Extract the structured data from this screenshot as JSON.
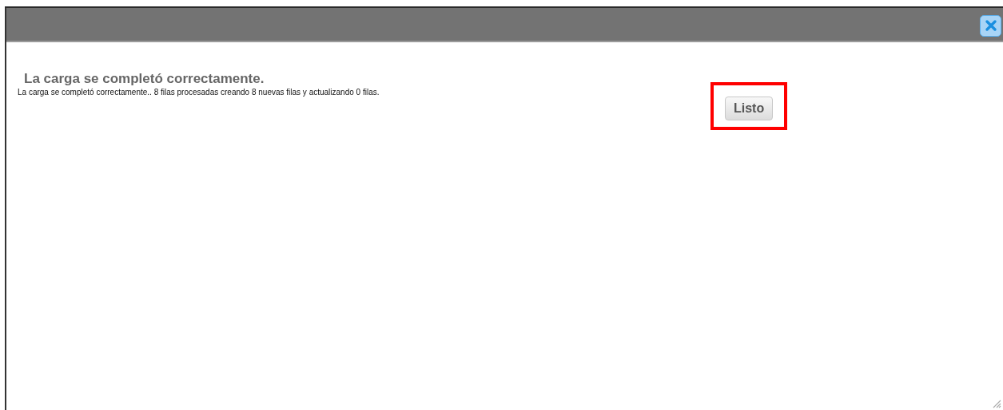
{
  "dialog": {
    "closable": true,
    "resizable": true
  },
  "content": {
    "title": "La carga se completó correctamente.",
    "message": "La carga se completó correctamente.. 8 filas procesadas creando 8 nuevas filas y actualizando 0 filas."
  },
  "button": {
    "label": "Listo",
    "highlighted": true
  }
}
